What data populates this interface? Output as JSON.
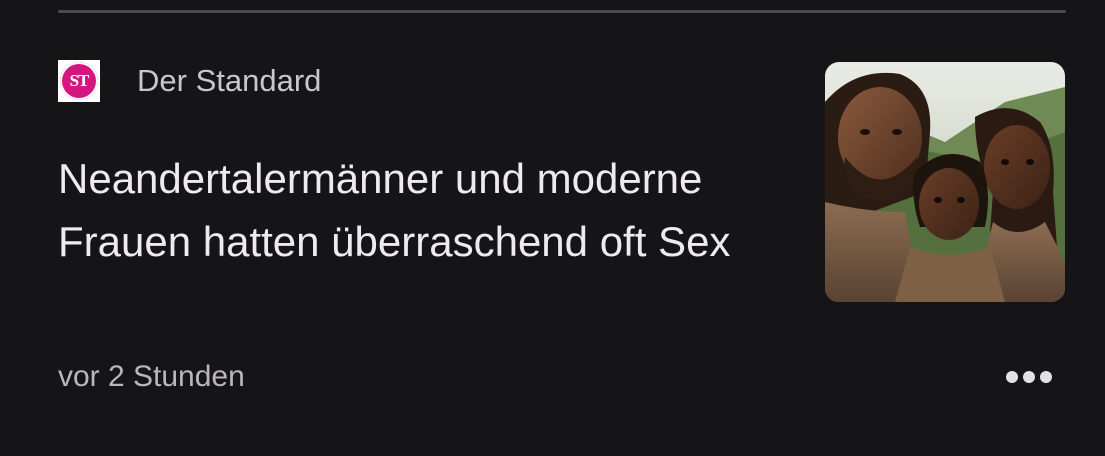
{
  "article": {
    "source": {
      "name": "Der Standard",
      "logo_text": "ST",
      "logo_color": "#d6167f"
    },
    "headline": "Neandertalermänner und moderne Frauen hatten überraschend oft Sex",
    "timestamp": "vor 2 Stunden",
    "thumbnail": {
      "alt": "Neandertaler-Mann, Frau und Kind"
    },
    "more_icon": "more-horizontal-icon"
  },
  "colors": {
    "background": "#151417",
    "divider": "#4a494d",
    "text_primary": "#eeebf0",
    "text_secondary": "#b9b6bc"
  }
}
